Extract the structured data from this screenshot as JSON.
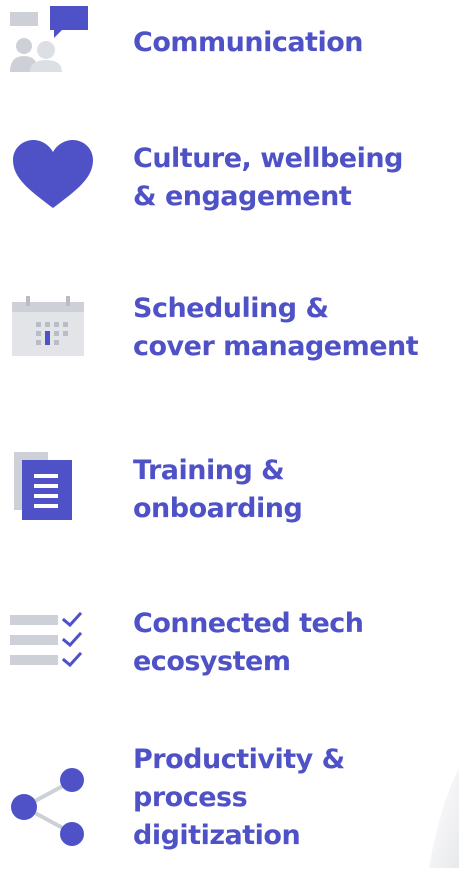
{
  "colors": {
    "accent": "#4f52c7",
    "icon_gray": "#cdd0d6",
    "icon_gray_light": "#e2e4e8"
  },
  "items": [
    {
      "label": "Communication",
      "icon": "chat-people-icon"
    },
    {
      "label": "Culture, wellbeing\n& engagement",
      "icon": "heart-icon"
    },
    {
      "label": "Scheduling &\ncover management",
      "icon": "calendar-icon"
    },
    {
      "label": "Training &\nonboarding",
      "icon": "document-icon"
    },
    {
      "label": "Connected tech\necosystem",
      "icon": "checklist-icon"
    },
    {
      "label": "Productivity &\nprocess\ndigitization",
      "icon": "share-icon"
    }
  ]
}
